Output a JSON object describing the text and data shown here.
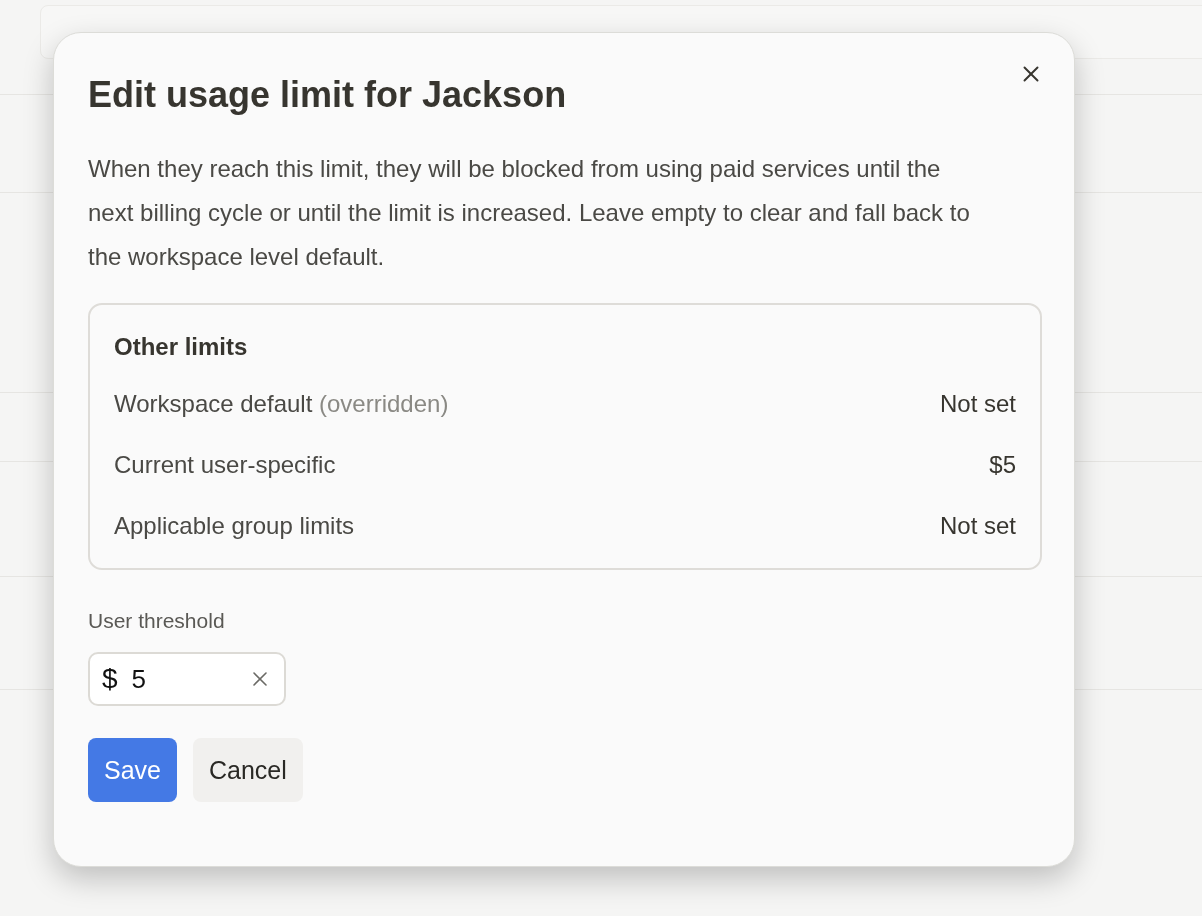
{
  "dialog": {
    "title": "Edit usage limit for Jackson",
    "description": "When they reach this limit, they will be blocked from using paid services until the next billing cycle or until the limit is increased. Leave empty to clear and fall back to the workspace level default.",
    "other_limits": {
      "title": "Other limits",
      "rows": [
        {
          "label": "Workspace default",
          "note": "(overridden)",
          "value": "Not set"
        },
        {
          "label": "Current user-specific",
          "value": "$5"
        },
        {
          "label": "Applicable group limits",
          "value": "Not set"
        }
      ]
    },
    "threshold": {
      "label": "User threshold",
      "currency_symbol": "$",
      "value": "5"
    },
    "buttons": [
      {
        "label": "Save",
        "kind": "primary"
      },
      {
        "label": "Cancel",
        "kind": "secondary"
      }
    ]
  }
}
